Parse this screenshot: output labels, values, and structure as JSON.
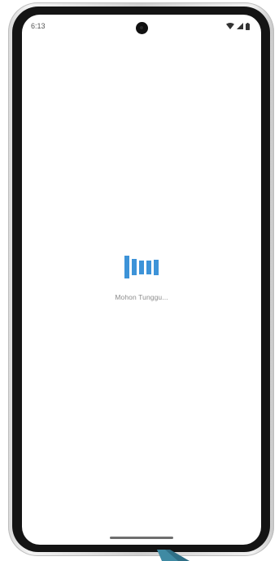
{
  "status_bar": {
    "time": "6:13",
    "icons": [
      "wifi-icon",
      "cellular-signal-icon",
      "battery-icon"
    ]
  },
  "loading": {
    "message": "Mohon Tunggu...",
    "accent_color": "#3d93d8",
    "bar_levels": [
      1.0,
      0.72,
      0.6,
      0.6,
      0.68
    ]
  },
  "colors": {
    "screen_background": "#ffffff",
    "bezel": "#141414",
    "text_muted": "#8c8c8c"
  }
}
